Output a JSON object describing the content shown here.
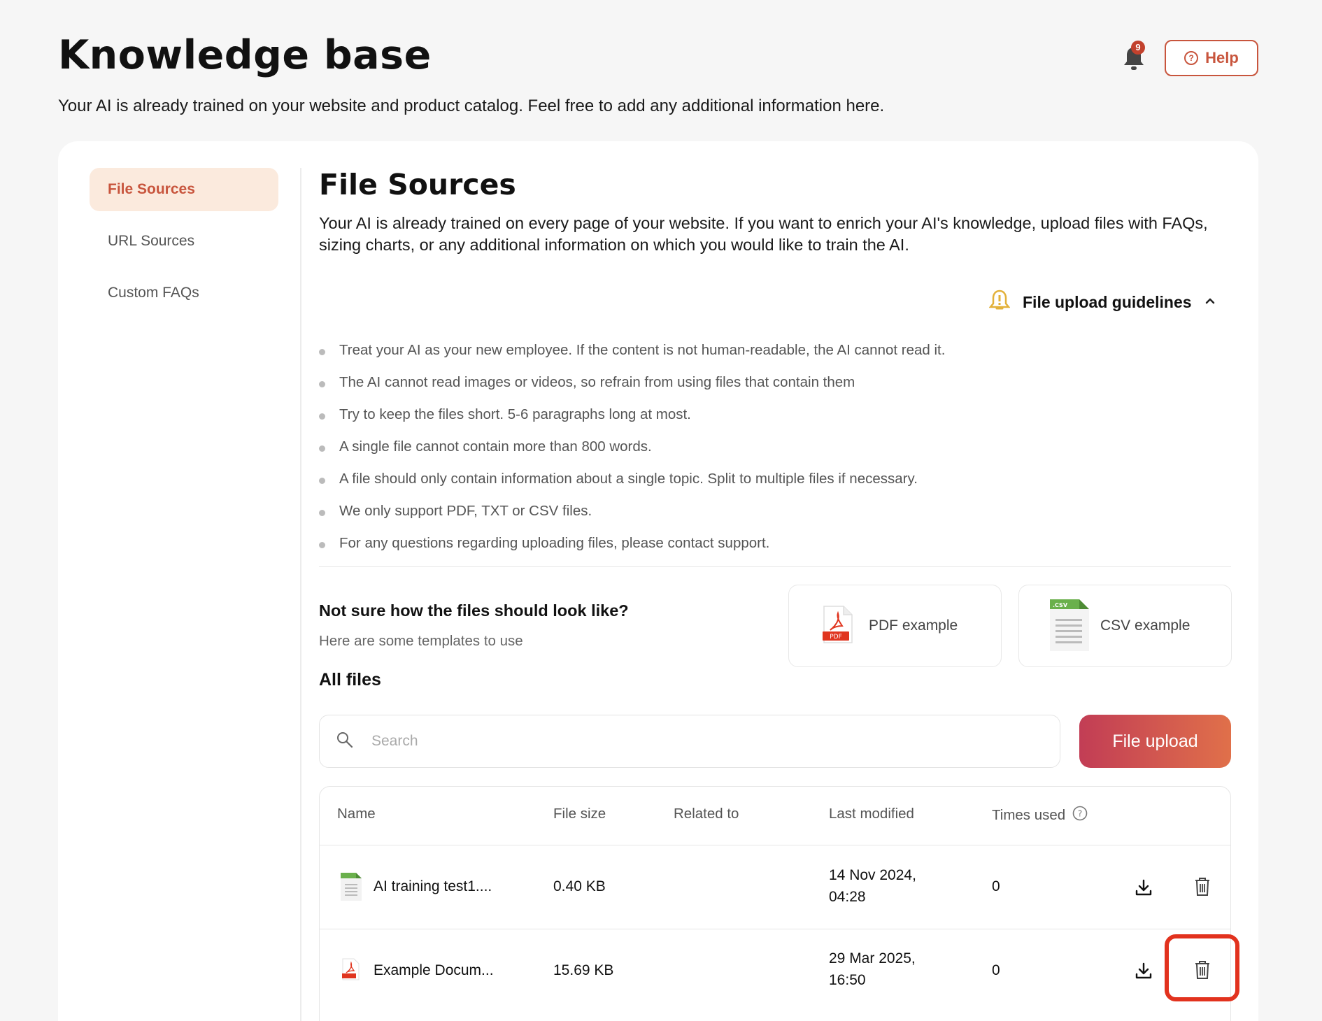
{
  "header": {
    "title": "Knowledge base",
    "subtitle": "Your AI is already trained on your website and product catalog. Feel free to add any additional information here.",
    "notification_count": "9",
    "help_label": "Help"
  },
  "sidebar": {
    "items": [
      {
        "label": "File Sources",
        "active": true
      },
      {
        "label": "URL Sources",
        "active": false
      },
      {
        "label": "Custom FAQs",
        "active": false
      }
    ]
  },
  "main": {
    "title": "File Sources",
    "description": "Your AI is already trained on every page of your website. If you want to enrich your AI's knowledge, upload files with FAQs, sizing charts, or any additional information on which you would like to train the AI.",
    "guidelines_title": "File upload guidelines",
    "guidelines": [
      "Treat your AI as your new employee. If the content is not human-readable, the AI cannot read it.",
      "The AI cannot read images or videos, so refrain from using files that contain them",
      "Try to keep the files short. 5-6 paragraphs long at most.",
      "A single file cannot contain more than 800 words.",
      "A file should only contain information about a single topic. Split to multiple files if necessary.",
      "We only support PDF, TXT or CSV files.",
      "For any questions regarding uploading files, please contact support."
    ],
    "templates": {
      "title": "Not sure how the files should look like?",
      "subtitle": "Here are some templates to use",
      "pdf_label": "PDF example",
      "pdf_icon_text": "PDF",
      "csv_label": "CSV example",
      "csv_icon_text": ".CSV"
    },
    "all_files_title": "All files",
    "search_placeholder": "Search",
    "upload_label": "File upload"
  },
  "table": {
    "columns": {
      "name": "Name",
      "size": "File size",
      "related": "Related to",
      "modified": "Last modified",
      "used": "Times used"
    },
    "rows": [
      {
        "name": "AI training test1....",
        "type": "csv",
        "size": "0.40 KB",
        "related": "",
        "modified_date": "14 Nov 2024,",
        "modified_time": "04:28",
        "used": "0"
      },
      {
        "name": "Example Docum...",
        "type": "pdf",
        "size": "15.69 KB",
        "related": "",
        "modified_date": "29 Mar 2025,",
        "modified_time": "16:50",
        "used": "0"
      }
    ]
  },
  "colors": {
    "accent": "#c8553d",
    "highlight": "#e2321e"
  }
}
